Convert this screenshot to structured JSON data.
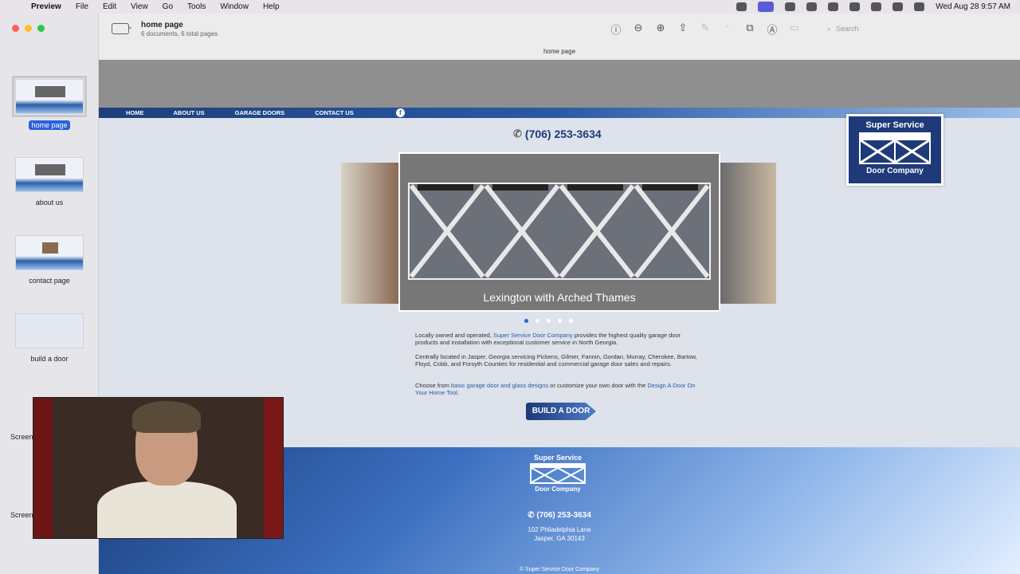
{
  "menubar": {
    "apple": "",
    "items": [
      "Preview",
      "File",
      "Edit",
      "View",
      "Go",
      "Tools",
      "Window",
      "Help"
    ],
    "datetime": "Wed Aug 28  9:57 AM"
  },
  "toolbar": {
    "title": "home page",
    "subtitle": "6 documents, 6 total pages",
    "search_placeholder": "Search",
    "doc_title": "home page"
  },
  "sidebar": {
    "thumbnails": [
      {
        "label": "home page",
        "selected": true
      },
      {
        "label": "about us",
        "selected": false
      },
      {
        "label": "contact page",
        "selected": false
      },
      {
        "label": "build a door",
        "selected": false
      },
      {
        "label": "Screen",
        "selected": false
      },
      {
        "label": "Screen",
        "selected": false
      }
    ]
  },
  "site": {
    "nav": [
      "HOME",
      "ABOUT US",
      "GARAGE DOORS",
      "CONTACT US"
    ],
    "facebook": "f",
    "phone": "(706) 253-3634",
    "logo": {
      "top": "Super Service",
      "bottom": "Door Company"
    },
    "slider_caption": "Lexington with Arched Thames",
    "slider_dots": 5,
    "para1_prefix": "Locally owned and operated, ",
    "para1_link": "Super Service Door Company",
    "para1_suffix": " provides the highest quality garage door products and installation with exceptional customer service in North Georgia.",
    "para2": "Centrally located in Jasper, Georgia servicing Pickens, Gilmer, Fannin, Gordan, Murray, Cherokee, Bartow, Floyd, Cobb, and Forsyth Counties for residential and commercial garage door sales and repairs.",
    "para3_prefix": "Choose from ",
    "para3_link1": "basic garage door and glass designs",
    "para3_mid": " or customize your own door with the ",
    "para3_link2": "Design A Door On Your Home Tool.",
    "build_button": "BUILD A DOOR",
    "footer": {
      "logo_top": "Super Service",
      "logo_bottom": "Door Company",
      "phone": "(706) 253-3634",
      "address1": "102 Philadelphia Lane",
      "address2": "Jasper, GA 30143",
      "copyright": "© Super Service Door Company"
    }
  }
}
